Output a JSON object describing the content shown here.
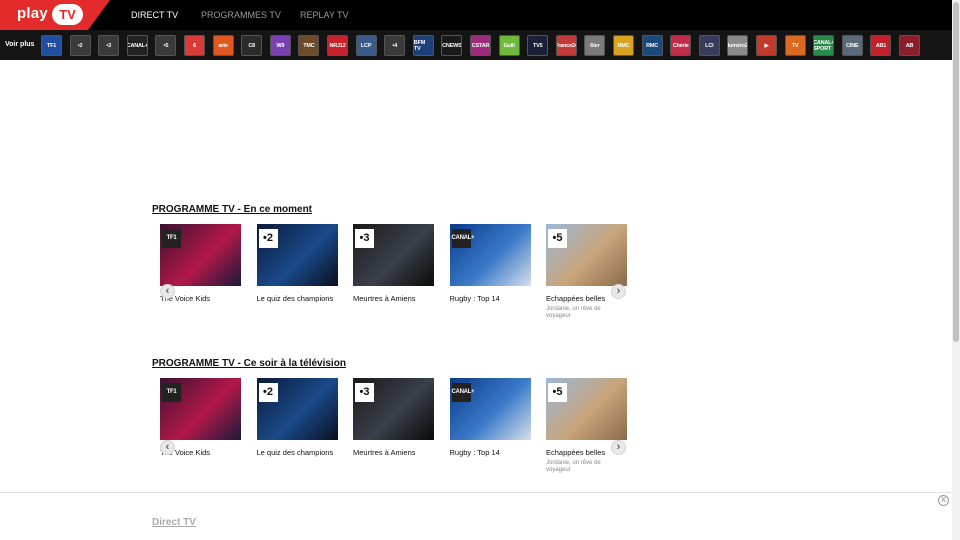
{
  "logo": {
    "play": "play",
    "tv": "TV"
  },
  "nav": [
    {
      "label": "DIRECT TV",
      "active": true
    },
    {
      "label": "PROGRAMMES TV",
      "active": false
    },
    {
      "label": "REPLAY TV",
      "active": false
    }
  ],
  "channels_bar": {
    "voir_plus": "Voir plus",
    "channels": [
      {
        "label": "TF1",
        "color": "#1f4fa3"
      },
      {
        "label": "•2",
        "color": "#3a3a3a"
      },
      {
        "label": "•3",
        "color": "#3a3a3a"
      },
      {
        "label": "CANAL+",
        "color": "#222222"
      },
      {
        "label": "•5",
        "color": "#3a3a3a"
      },
      {
        "label": "6",
        "color": "#d93a3a"
      },
      {
        "label": "arte",
        "color": "#e0581f"
      },
      {
        "label": "C8",
        "color": "#2b2b2b"
      },
      {
        "label": "W9",
        "color": "#7a3fb0"
      },
      {
        "label": "TMC",
        "color": "#6d4a2a"
      },
      {
        "label": "NRJ12",
        "color": "#c8232c"
      },
      {
        "label": "LCP",
        "color": "#3a5a8a"
      },
      {
        "label": "•4",
        "color": "#3a3a3a"
      },
      {
        "label": "BFM TV",
        "color": "#1d3f7a"
      },
      {
        "label": "CNEWS",
        "color": "#1a1a1a"
      },
      {
        "label": "CSTAR",
        "color": "#a02b7a"
      },
      {
        "label": "Gulli",
        "color": "#6fb83a"
      },
      {
        "label": "TV5",
        "color": "#1a1f3a"
      },
      {
        "label": "France24",
        "color": "#c23a3a"
      },
      {
        "label": "6ter",
        "color": "#7a7a7a"
      },
      {
        "label": "RMC",
        "color": "#d9a21f"
      },
      {
        "label": "RMC",
        "color": "#1a4a7a"
      },
      {
        "label": "Chérie",
        "color": "#c22a4a"
      },
      {
        "label": "LCI",
        "color": "#3a3a5a"
      },
      {
        "label": "Numéro23",
        "color": "#8a8a8a"
      },
      {
        "label": "▶",
        "color": "#c23a2a"
      },
      {
        "label": "TV",
        "color": "#d96a1f"
      },
      {
        "label": "CANAL+ SPORT",
        "color": "#2a8a4a"
      },
      {
        "label": "CINE",
        "color": "#5a6a7a"
      },
      {
        "label": "AB1",
        "color": "#c21f2a"
      },
      {
        "label": "AB",
        "color": "#8a1f2a"
      }
    ]
  },
  "sections": [
    {
      "title": "PROGRAMME TV - En ce moment",
      "cards": [
        {
          "channel": "TF1",
          "title": "The Voice Kids",
          "subtitle": "",
          "colors": [
            "#3a1230",
            "#b4174a",
            "#1a1a3a"
          ]
        },
        {
          "channel": "•2",
          "title": "Le quiz des champions",
          "subtitle": "",
          "colors": [
            "#0a1a3a",
            "#1a4a8a",
            "#0a0f20"
          ]
        },
        {
          "channel": "•3",
          "title": "Meurtres à Amiens",
          "subtitle": "",
          "colors": [
            "#1a1a1a",
            "#3a3f4a",
            "#0a0a0a"
          ]
        },
        {
          "channel": "CANAL+",
          "title": "Rugby : Top 14",
          "subtitle": "",
          "colors": [
            "#0a3a8a",
            "#3a7ac8",
            "#d8e0ea"
          ]
        },
        {
          "channel": "•5",
          "title": "Echappées belles",
          "subtitle": "Jordanie, un rêve de voyageur",
          "colors": [
            "#9ab8d8",
            "#c8a47a",
            "#8a6a4a"
          ]
        }
      ]
    },
    {
      "title": "PROGRAMME TV - Ce soir à la télévision",
      "cards": [
        {
          "channel": "TF1",
          "title": "The Voice Kids",
          "subtitle": "",
          "colors": [
            "#3a1230",
            "#b4174a",
            "#1a1a3a"
          ]
        },
        {
          "channel": "•2",
          "title": "Le quiz des champions",
          "subtitle": "",
          "colors": [
            "#0a1a3a",
            "#1a4a8a",
            "#0a0f20"
          ]
        },
        {
          "channel": "•3",
          "title": "Meurtres à Amiens",
          "subtitle": "",
          "colors": [
            "#1a1a1a",
            "#3a3f4a",
            "#0a0a0a"
          ]
        },
        {
          "channel": "CANAL+",
          "title": "Rugby : Top 14",
          "subtitle": "",
          "colors": [
            "#0a3a8a",
            "#3a7ac8",
            "#d8e0ea"
          ]
        },
        {
          "channel": "•5",
          "title": "Echappées belles",
          "subtitle": "Jordanie, un rêve de voyageur",
          "colors": [
            "#9ab8d8",
            "#c8a47a",
            "#8a6a4a"
          ]
        }
      ]
    }
  ],
  "carousel": {
    "prev": "‹",
    "next": "›"
  },
  "bottom": {
    "direct_tv": "Direct TV",
    "close": "X"
  }
}
